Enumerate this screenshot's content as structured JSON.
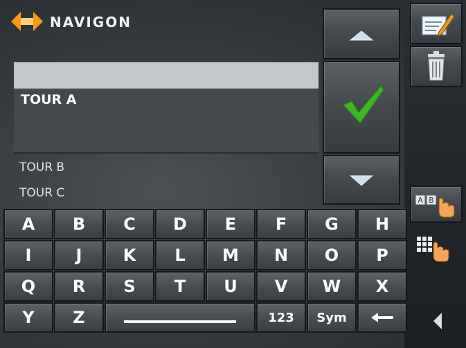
{
  "header": {
    "brand": "NAVIGON"
  },
  "list": {
    "filter_value": "",
    "selected": "TOUR A",
    "items": [
      "TOUR B",
      "TOUR C"
    ]
  },
  "keyboard": {
    "rows": [
      [
        "A",
        "B",
        "C",
        "D",
        "E",
        "F",
        "G",
        "H"
      ],
      [
        "I",
        "J",
        "K",
        "L",
        "M",
        "N",
        "O",
        "P"
      ],
      [
        "Q",
        "R",
        "S",
        "T",
        "U",
        "V",
        "W",
        "X"
      ]
    ],
    "last_row": [
      "Y",
      "Z"
    ],
    "num_label": "123",
    "sym_label": "Sym"
  },
  "icons": {
    "logo": "navigon-logo-icon",
    "up": "arrow-up-icon",
    "ok": "checkmark-icon",
    "down": "arrow-down-icon",
    "edit": "edit-note-icon",
    "delete": "trash-icon",
    "ab": "keyboard-abc-icon",
    "grid": "keypad-grid-icon",
    "back": "back-triangle-icon",
    "backspace": "backspace-arrow-icon",
    "space": "space-bar-icon"
  },
  "colors": {
    "check_green": "#3fb42a",
    "logo_orange": "#f39a1e",
    "arrow_blue": "#c9dff0"
  }
}
